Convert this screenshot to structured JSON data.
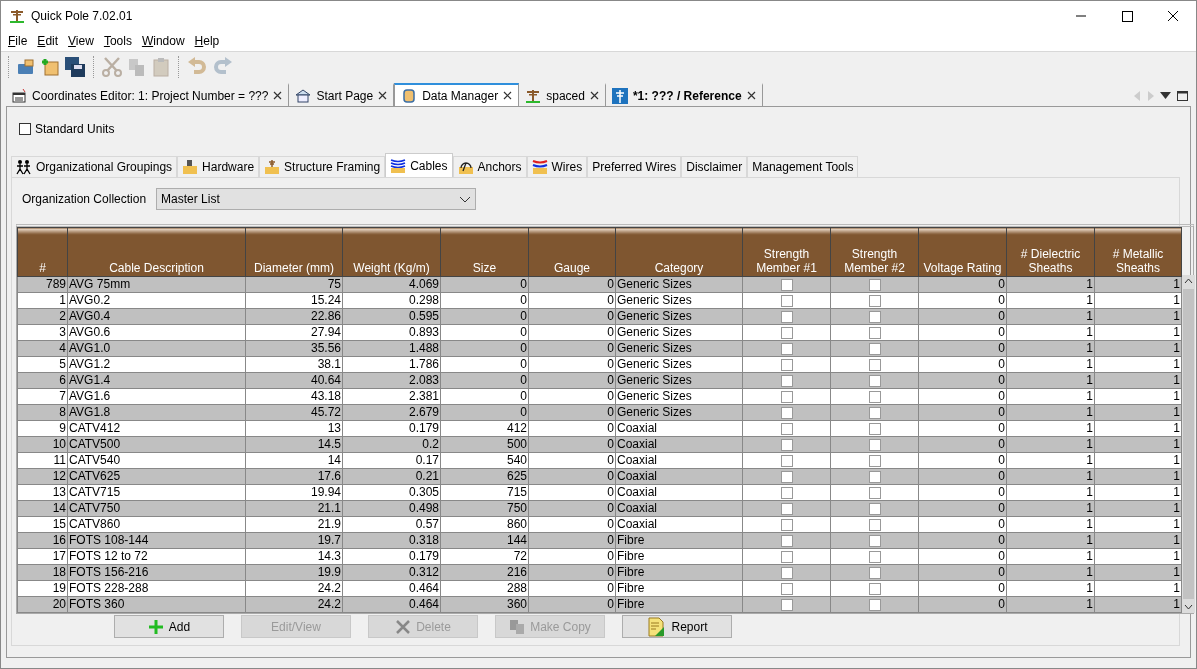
{
  "window": {
    "title": "Quick Pole 7.02.01"
  },
  "menu": [
    "File",
    "Edit",
    "View",
    "Tools",
    "Window",
    "Help"
  ],
  "toolbar": [
    {
      "kind": "open",
      "disabled": false
    },
    {
      "kind": "new",
      "disabled": false
    },
    {
      "kind": "save",
      "disabled": false
    },
    {
      "kind": "cut",
      "disabled": true
    },
    {
      "kind": "copy",
      "disabled": true
    },
    {
      "kind": "paste",
      "disabled": true
    },
    {
      "kind": "undo",
      "disabled": true
    },
    {
      "kind": "redo",
      "disabled": true
    }
  ],
  "document_tabs": [
    {
      "kind": "editor",
      "label": "Coordinates Editor: 1: Project Number = ???",
      "selected": false,
      "modified": false
    },
    {
      "kind": "home",
      "label": "Start Page",
      "selected": false,
      "modified": false
    },
    {
      "kind": "data",
      "label": "Data Manager",
      "selected": true,
      "modified": false
    },
    {
      "kind": "pole",
      "label": "spaced",
      "selected": false,
      "modified": false
    },
    {
      "kind": "reference",
      "label": "*1: ??? / Reference",
      "selected": false,
      "modified": true
    }
  ],
  "standard_units": {
    "label": "Standard Units",
    "checked": false
  },
  "tabs": [
    {
      "kind": "groups",
      "label": "Organizational Groupings",
      "selected": false
    },
    {
      "kind": "hardware",
      "label": "Hardware",
      "selected": false
    },
    {
      "kind": "framing",
      "label": "Structure Framing",
      "selected": false
    },
    {
      "kind": "cables",
      "label": "Cables",
      "selected": true
    },
    {
      "kind": "anchors",
      "label": "Anchors",
      "selected": false
    },
    {
      "kind": "wires",
      "label": "Wires",
      "selected": false
    },
    {
      "kind": "none",
      "label": "Preferred Wires",
      "selected": false
    },
    {
      "kind": "none",
      "label": "Disclaimer",
      "selected": false
    },
    {
      "kind": "none",
      "label": "Management Tools",
      "selected": false
    }
  ],
  "organization_collection": {
    "label": "Organization Collection",
    "value": "Master List"
  },
  "table": {
    "columns": [
      "#",
      "Cable Description",
      "Diameter (mm)",
      "Weight (Kg/m)",
      "Size",
      "Gauge",
      "Category",
      "Strength Member #1",
      "Strength Member #2",
      "Voltage Rating",
      "# Dielectric Sheaths",
      "# Metallic Sheaths"
    ],
    "rows": [
      {
        "number": "789",
        "description": "AVG 75mm",
        "diameter": "75",
        "weight": "4.069",
        "size": "0",
        "gauge": "0",
        "category": "Generic Sizes",
        "strength_member_1": false,
        "strength_member_2": false,
        "voltage_rating": "0",
        "dielectric_sheaths": "1",
        "metallic_sheaths": "1"
      },
      {
        "number": "1",
        "description": "AVG0.2",
        "diameter": "15.24",
        "weight": "0.298",
        "size": "0",
        "gauge": "0",
        "category": "Generic Sizes",
        "strength_member_1": false,
        "strength_member_2": false,
        "voltage_rating": "0",
        "dielectric_sheaths": "1",
        "metallic_sheaths": "1"
      },
      {
        "number": "2",
        "description": "AVG0.4",
        "diameter": "22.86",
        "weight": "0.595",
        "size": "0",
        "gauge": "0",
        "category": "Generic Sizes",
        "strength_member_1": false,
        "strength_member_2": false,
        "voltage_rating": "0",
        "dielectric_sheaths": "1",
        "metallic_sheaths": "1"
      },
      {
        "number": "3",
        "description": "AVG0.6",
        "diameter": "27.94",
        "weight": "0.893",
        "size": "0",
        "gauge": "0",
        "category": "Generic Sizes",
        "strength_member_1": false,
        "strength_member_2": false,
        "voltage_rating": "0",
        "dielectric_sheaths": "1",
        "metallic_sheaths": "1"
      },
      {
        "number": "4",
        "description": "AVG1.0",
        "diameter": "35.56",
        "weight": "1.488",
        "size": "0",
        "gauge": "0",
        "category": "Generic Sizes",
        "strength_member_1": false,
        "strength_member_2": false,
        "voltage_rating": "0",
        "dielectric_sheaths": "1",
        "metallic_sheaths": "1"
      },
      {
        "number": "5",
        "description": "AVG1.2",
        "diameter": "38.1",
        "weight": "1.786",
        "size": "0",
        "gauge": "0",
        "category": "Generic Sizes",
        "strength_member_1": false,
        "strength_member_2": false,
        "voltage_rating": "0",
        "dielectric_sheaths": "1",
        "metallic_sheaths": "1"
      },
      {
        "number": "6",
        "description": "AVG1.4",
        "diameter": "40.64",
        "weight": "2.083",
        "size": "0",
        "gauge": "0",
        "category": "Generic Sizes",
        "strength_member_1": false,
        "strength_member_2": false,
        "voltage_rating": "0",
        "dielectric_sheaths": "1",
        "metallic_sheaths": "1"
      },
      {
        "number": "7",
        "description": "AVG1.6",
        "diameter": "43.18",
        "weight": "2.381",
        "size": "0",
        "gauge": "0",
        "category": "Generic Sizes",
        "strength_member_1": false,
        "strength_member_2": false,
        "voltage_rating": "0",
        "dielectric_sheaths": "1",
        "metallic_sheaths": "1"
      },
      {
        "number": "8",
        "description": "AVG1.8",
        "diameter": "45.72",
        "weight": "2.679",
        "size": "0",
        "gauge": "0",
        "category": "Generic Sizes",
        "strength_member_1": false,
        "strength_member_2": false,
        "voltage_rating": "0",
        "dielectric_sheaths": "1",
        "metallic_sheaths": "1"
      },
      {
        "number": "9",
        "description": "CATV412",
        "diameter": "13",
        "weight": "0.179",
        "size": "412",
        "gauge": "0",
        "category": "Coaxial",
        "strength_member_1": false,
        "strength_member_2": false,
        "voltage_rating": "0",
        "dielectric_sheaths": "1",
        "metallic_sheaths": "1"
      },
      {
        "number": "10",
        "description": "CATV500",
        "diameter": "14.5",
        "weight": "0.2",
        "size": "500",
        "gauge": "0",
        "category": "Coaxial",
        "strength_member_1": false,
        "strength_member_2": false,
        "voltage_rating": "0",
        "dielectric_sheaths": "1",
        "metallic_sheaths": "1"
      },
      {
        "number": "11",
        "description": "CATV540",
        "diameter": "14",
        "weight": "0.17",
        "size": "540",
        "gauge": "0",
        "category": "Coaxial",
        "strength_member_1": false,
        "strength_member_2": false,
        "voltage_rating": "0",
        "dielectric_sheaths": "1",
        "metallic_sheaths": "1"
      },
      {
        "number": "12",
        "description": "CATV625",
        "diameter": "17.6",
        "weight": "0.21",
        "size": "625",
        "gauge": "0",
        "category": "Coaxial",
        "strength_member_1": false,
        "strength_member_2": false,
        "voltage_rating": "0",
        "dielectric_sheaths": "1",
        "metallic_sheaths": "1"
      },
      {
        "number": "13",
        "description": "CATV715",
        "diameter": "19.94",
        "weight": "0.305",
        "size": "715",
        "gauge": "0",
        "category": "Coaxial",
        "strength_member_1": false,
        "strength_member_2": false,
        "voltage_rating": "0",
        "dielectric_sheaths": "1",
        "metallic_sheaths": "1"
      },
      {
        "number": "14",
        "description": "CATV750",
        "diameter": "21.1",
        "weight": "0.498",
        "size": "750",
        "gauge": "0",
        "category": "Coaxial",
        "strength_member_1": false,
        "strength_member_2": false,
        "voltage_rating": "0",
        "dielectric_sheaths": "1",
        "metallic_sheaths": "1"
      },
      {
        "number": "15",
        "description": "CATV860",
        "diameter": "21.9",
        "weight": "0.57",
        "size": "860",
        "gauge": "0",
        "category": "Coaxial",
        "strength_member_1": false,
        "strength_member_2": false,
        "voltage_rating": "0",
        "dielectric_sheaths": "1",
        "metallic_sheaths": "1"
      },
      {
        "number": "16",
        "description": "FOTS 108-144",
        "diameter": "19.7",
        "weight": "0.318",
        "size": "144",
        "gauge": "0",
        "category": "Fibre",
        "strength_member_1": false,
        "strength_member_2": false,
        "voltage_rating": "0",
        "dielectric_sheaths": "1",
        "metallic_sheaths": "1"
      },
      {
        "number": "17",
        "description": "FOTS 12 to 72",
        "diameter": "14.3",
        "weight": "0.179",
        "size": "72",
        "gauge": "0",
        "category": "Fibre",
        "strength_member_1": false,
        "strength_member_2": false,
        "voltage_rating": "0",
        "dielectric_sheaths": "1",
        "metallic_sheaths": "1"
      },
      {
        "number": "18",
        "description": "FOTS 156-216",
        "diameter": "19.9",
        "weight": "0.312",
        "size": "216",
        "gauge": "0",
        "category": "Fibre",
        "strength_member_1": false,
        "strength_member_2": false,
        "voltage_rating": "0",
        "dielectric_sheaths": "1",
        "metallic_sheaths": "1"
      },
      {
        "number": "19",
        "description": "FOTS 228-288",
        "diameter": "24.2",
        "weight": "0.464",
        "size": "288",
        "gauge": "0",
        "category": "Fibre",
        "strength_member_1": false,
        "strength_member_2": false,
        "voltage_rating": "0",
        "dielectric_sheaths": "1",
        "metallic_sheaths": "1"
      },
      {
        "number": "20",
        "description": "FOTS 360",
        "diameter": "24.2",
        "weight": "0.464",
        "size": "360",
        "gauge": "0",
        "category": "Fibre",
        "strength_member_1": false,
        "strength_member_2": false,
        "voltage_rating": "0",
        "dielectric_sheaths": "1",
        "metallic_sheaths": "1"
      }
    ]
  },
  "buttons": [
    {
      "kind": "add",
      "label": "Add",
      "disabled": false
    },
    {
      "kind": "none",
      "label": "Edit/View",
      "disabled": true
    },
    {
      "kind": "delete",
      "label": "Delete",
      "disabled": true
    },
    {
      "kind": "copy",
      "label": "Make Copy",
      "disabled": true
    },
    {
      "kind": "report",
      "label": "Report",
      "disabled": false
    }
  ]
}
